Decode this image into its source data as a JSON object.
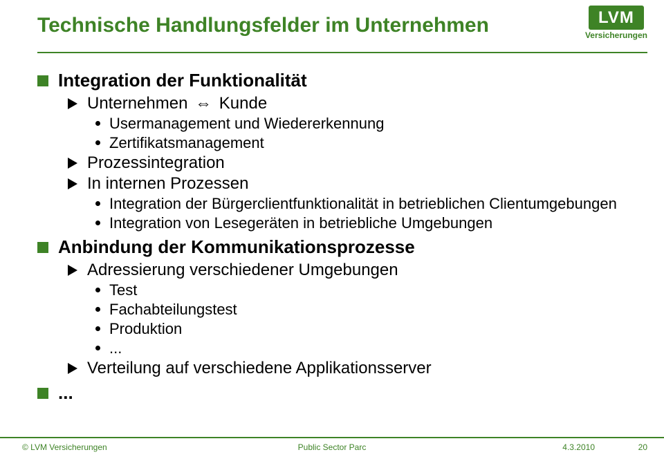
{
  "title": "Technische Handlungsfelder im Unternehmen",
  "logo": {
    "top": "LVM",
    "sub": "Versicherungen"
  },
  "content": {
    "p1": {
      "label": "Integration der Funktionalität",
      "sub1": {
        "pre": "Unternehmen",
        "arrow": "⇔",
        "post": "Kunde",
        "b1": "Usermanagement und Wiedererkennung",
        "b2": "Zertifikatsmanagement"
      },
      "sub2": {
        "label": "Prozessintegration"
      },
      "sub3": {
        "label": "In internen Prozessen",
        "b1": "Integration der Bürgerclientfunktionalität in betrieblichen Clientumgebungen",
        "b2": "Integration von Lesegeräten in betriebliche Umgebungen"
      }
    },
    "p2": {
      "label": "Anbindung der Kommunikationsprozesse",
      "sub1": {
        "label": "Adressierung verschiedener Umgebungen",
        "b1": "Test",
        "b2": "Fachabteilungstest",
        "b3": "Produktion",
        "b4": "..."
      },
      "sub2": {
        "label": "Verteilung auf verschiedene Applikationsserver"
      }
    },
    "p3": {
      "label": "..."
    }
  },
  "footer": {
    "left": "© LVM Versicherungen",
    "center": "Public Sector Parc",
    "date": "4.3.2010",
    "page": "20"
  }
}
